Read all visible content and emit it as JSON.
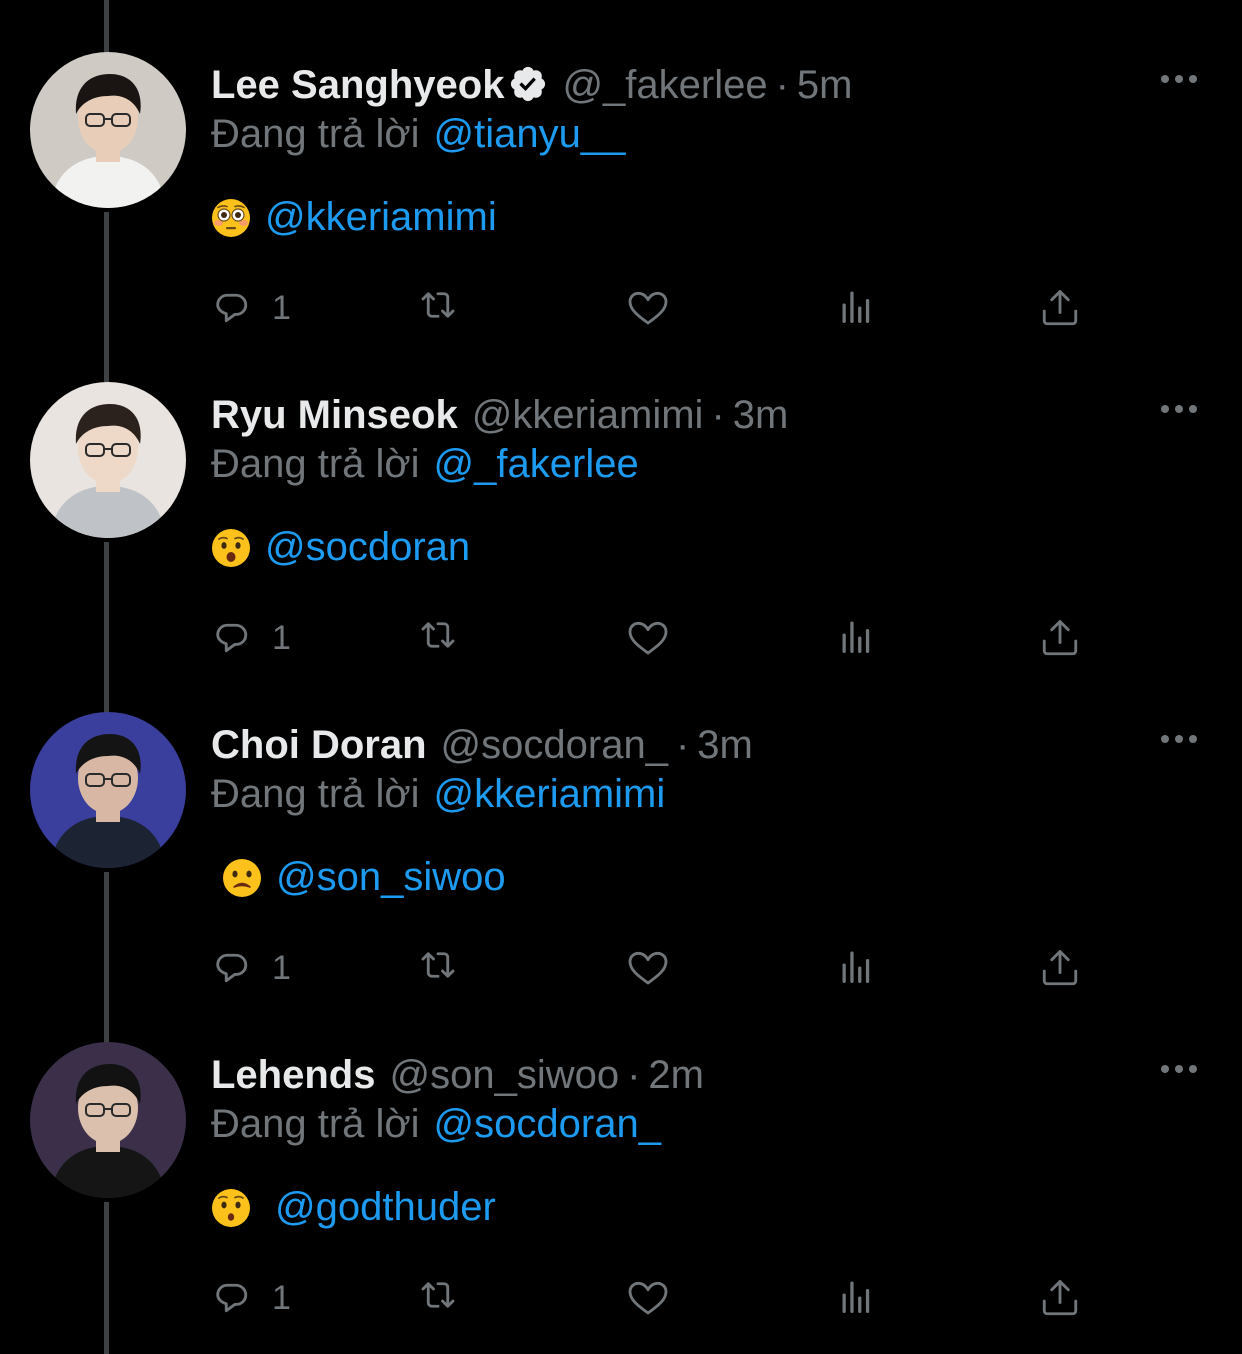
{
  "colors": {
    "background": "#000000",
    "text_primary": "#e7e9ea",
    "text_secondary": "#71767b",
    "accent": "#1d9bf0",
    "thread_line": "#3e4144"
  },
  "tweets": [
    {
      "display_name": "Lee Sanghyeok",
      "verified": true,
      "handle": "@_fakerlee",
      "separator": "·",
      "time": "5m",
      "reply_prefix": "Đang trả lời",
      "reply_to": "@tianyu__",
      "emoji": "flushed-face",
      "mention": "@kkeriamimi",
      "reply_count": "1",
      "avatar": "avatar-lee-sanghyeok",
      "avatar_colors": {
        "bg": "#cfcac3",
        "hair": "#1a1512",
        "skin": "#e8cdb8",
        "shirt": "#f2f2f0"
      }
    },
    {
      "display_name": "Ryu Minseok",
      "verified": false,
      "handle": "@kkeriamimi",
      "separator": "·",
      "time": "3m",
      "reply_prefix": "Đang trả lời",
      "reply_to": "@_fakerlee",
      "emoji": "anguished-face",
      "mention": "@socdoran",
      "reply_count": "1",
      "avatar": "avatar-ryu-minseok",
      "avatar_colors": {
        "bg": "#e9e4df",
        "hair": "#2b221d",
        "skin": "#eed9c9",
        "shirt": "#bfc3c8"
      }
    },
    {
      "display_name": "Choi Doran",
      "verified": false,
      "handle": "@socdoran_",
      "separator": "·",
      "time": "3m",
      "reply_prefix": "Đang trả lời",
      "reply_to": "@kkeriamimi",
      "emoji": "frowning-face",
      "mention": "@son_siwoo",
      "reply_count": "1",
      "avatar": "avatar-choi-doran",
      "avatar_colors": {
        "bg": "#3a3f9e",
        "hair": "#141414",
        "skin": "#d8b8a4",
        "shirt": "#1c2333"
      }
    },
    {
      "display_name": "Lehends",
      "verified": false,
      "handle": "@son_siwoo",
      "separator": "·",
      "time": "2m",
      "reply_prefix": "Đang trả lời",
      "reply_to": "@socdoran_",
      "emoji": "hushed-face",
      "mention": "@godthuder",
      "reply_count": "1",
      "avatar": "avatar-lehends",
      "avatar_colors": {
        "bg": "#3b2f4a",
        "hair": "#121212",
        "skin": "#dcc0ae",
        "shirt": "#151515"
      }
    }
  ],
  "action_icons": [
    "reply-icon",
    "retweet-icon",
    "like-icon",
    "views-icon",
    "share-icon"
  ],
  "more_icon": "more-icon"
}
